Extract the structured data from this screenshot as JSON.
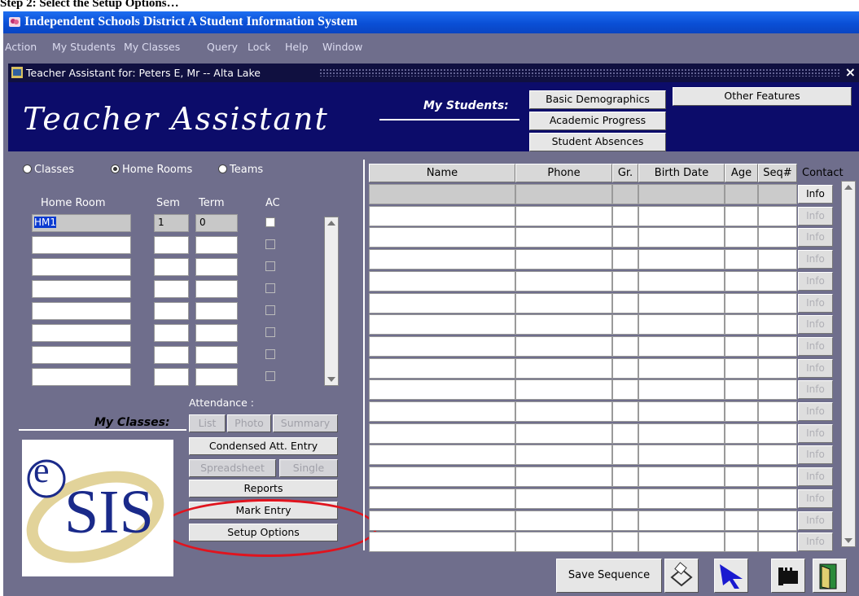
{
  "caption": "Step 2: Select the Setup Options…",
  "window": {
    "title": "Independent Schools District A Student Information System",
    "subtitle": "Teacher Assistant for: Peters E, Mr -- Alta Lake",
    "close": "×"
  },
  "menu": [
    "Action",
    "My Students",
    "My Classes",
    "Query",
    "Lock",
    "Help",
    "Window"
  ],
  "header": {
    "app_title": "Teacher Assistant",
    "my_students_label": "My Students:",
    "buttons": [
      "Basic Demographics",
      "Academic Progress",
      "Student Absences",
      "Other Features"
    ]
  },
  "filter": {
    "options": [
      "Classes",
      "Home Rooms",
      "Teams"
    ],
    "selected": "Home Rooms"
  },
  "homeroom_table": {
    "headers": [
      "Home Room",
      "Sem",
      "Term",
      "AC"
    ],
    "first_row": {
      "home_room": "HM1",
      "sem": "1",
      "term": "0"
    }
  },
  "attendance": {
    "label": "Attendance :",
    "buttons": [
      "List",
      "Photo",
      "Summary"
    ]
  },
  "my_classes_label": "My Classes:",
  "actions": {
    "condensed": "Condensed Att. Entry",
    "spreadsheet": "Spreadsheet",
    "single": "Single",
    "reports": "Reports",
    "mark_entry": "Mark Entry",
    "setup_options": "Setup Options"
  },
  "logo": {
    "letter_e": "e",
    "text": "SIS"
  },
  "students_grid": {
    "headers": [
      "Name",
      "Phone",
      "Gr.",
      "Birth Date",
      "Age",
      "Seq#",
      "Contact"
    ],
    "info_label": "Info",
    "row_count": 16
  },
  "bottom": {
    "save_sequence": "Save Sequence"
  },
  "colors": {
    "title_blue": "#0a4fd6",
    "panel": "#6f6e8c",
    "header_navy": "#0c0c6a",
    "highlight": "#e0141e"
  }
}
